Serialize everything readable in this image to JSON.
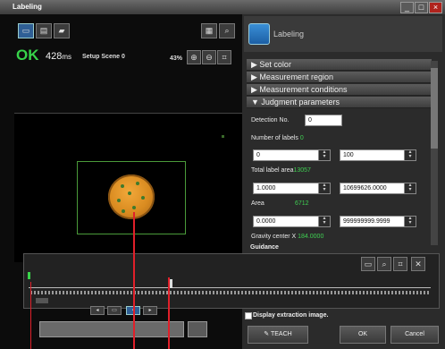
{
  "window": {
    "title": "Labeling"
  },
  "result": {
    "status": "OK",
    "time_value": "428",
    "time_unit": "ms",
    "scene": "Setup Scene 0",
    "zoom": "43%"
  },
  "panel": {
    "title": "Labeling",
    "sections": [
      "Set color",
      "Measurement region",
      "Measurement conditions",
      "Judgment parameters"
    ],
    "detection_no_label": "Detection No.",
    "detection_no_value": "0",
    "number_of_labels_label": "Number of labels",
    "number_of_labels_value": "0",
    "labels_min": "0",
    "labels_max": "100",
    "total_area_label": "Total label area",
    "total_area_value": "13057",
    "total_area_min": "1.0000",
    "total_area_max": "10699626.0000",
    "area_label": "Area",
    "area_value": "6712",
    "area_min": "0.0000",
    "area_max": "999999999.9999",
    "gravity_label": "Gravity center X",
    "gravity_value": "184.0000"
  },
  "guidance": {
    "title": "Guidance"
  },
  "bottom": {
    "display_image_label": "Display extraction image.",
    "teach_label": "TEACH",
    "ok_label": "OK",
    "cancel_label": "Cancel"
  }
}
